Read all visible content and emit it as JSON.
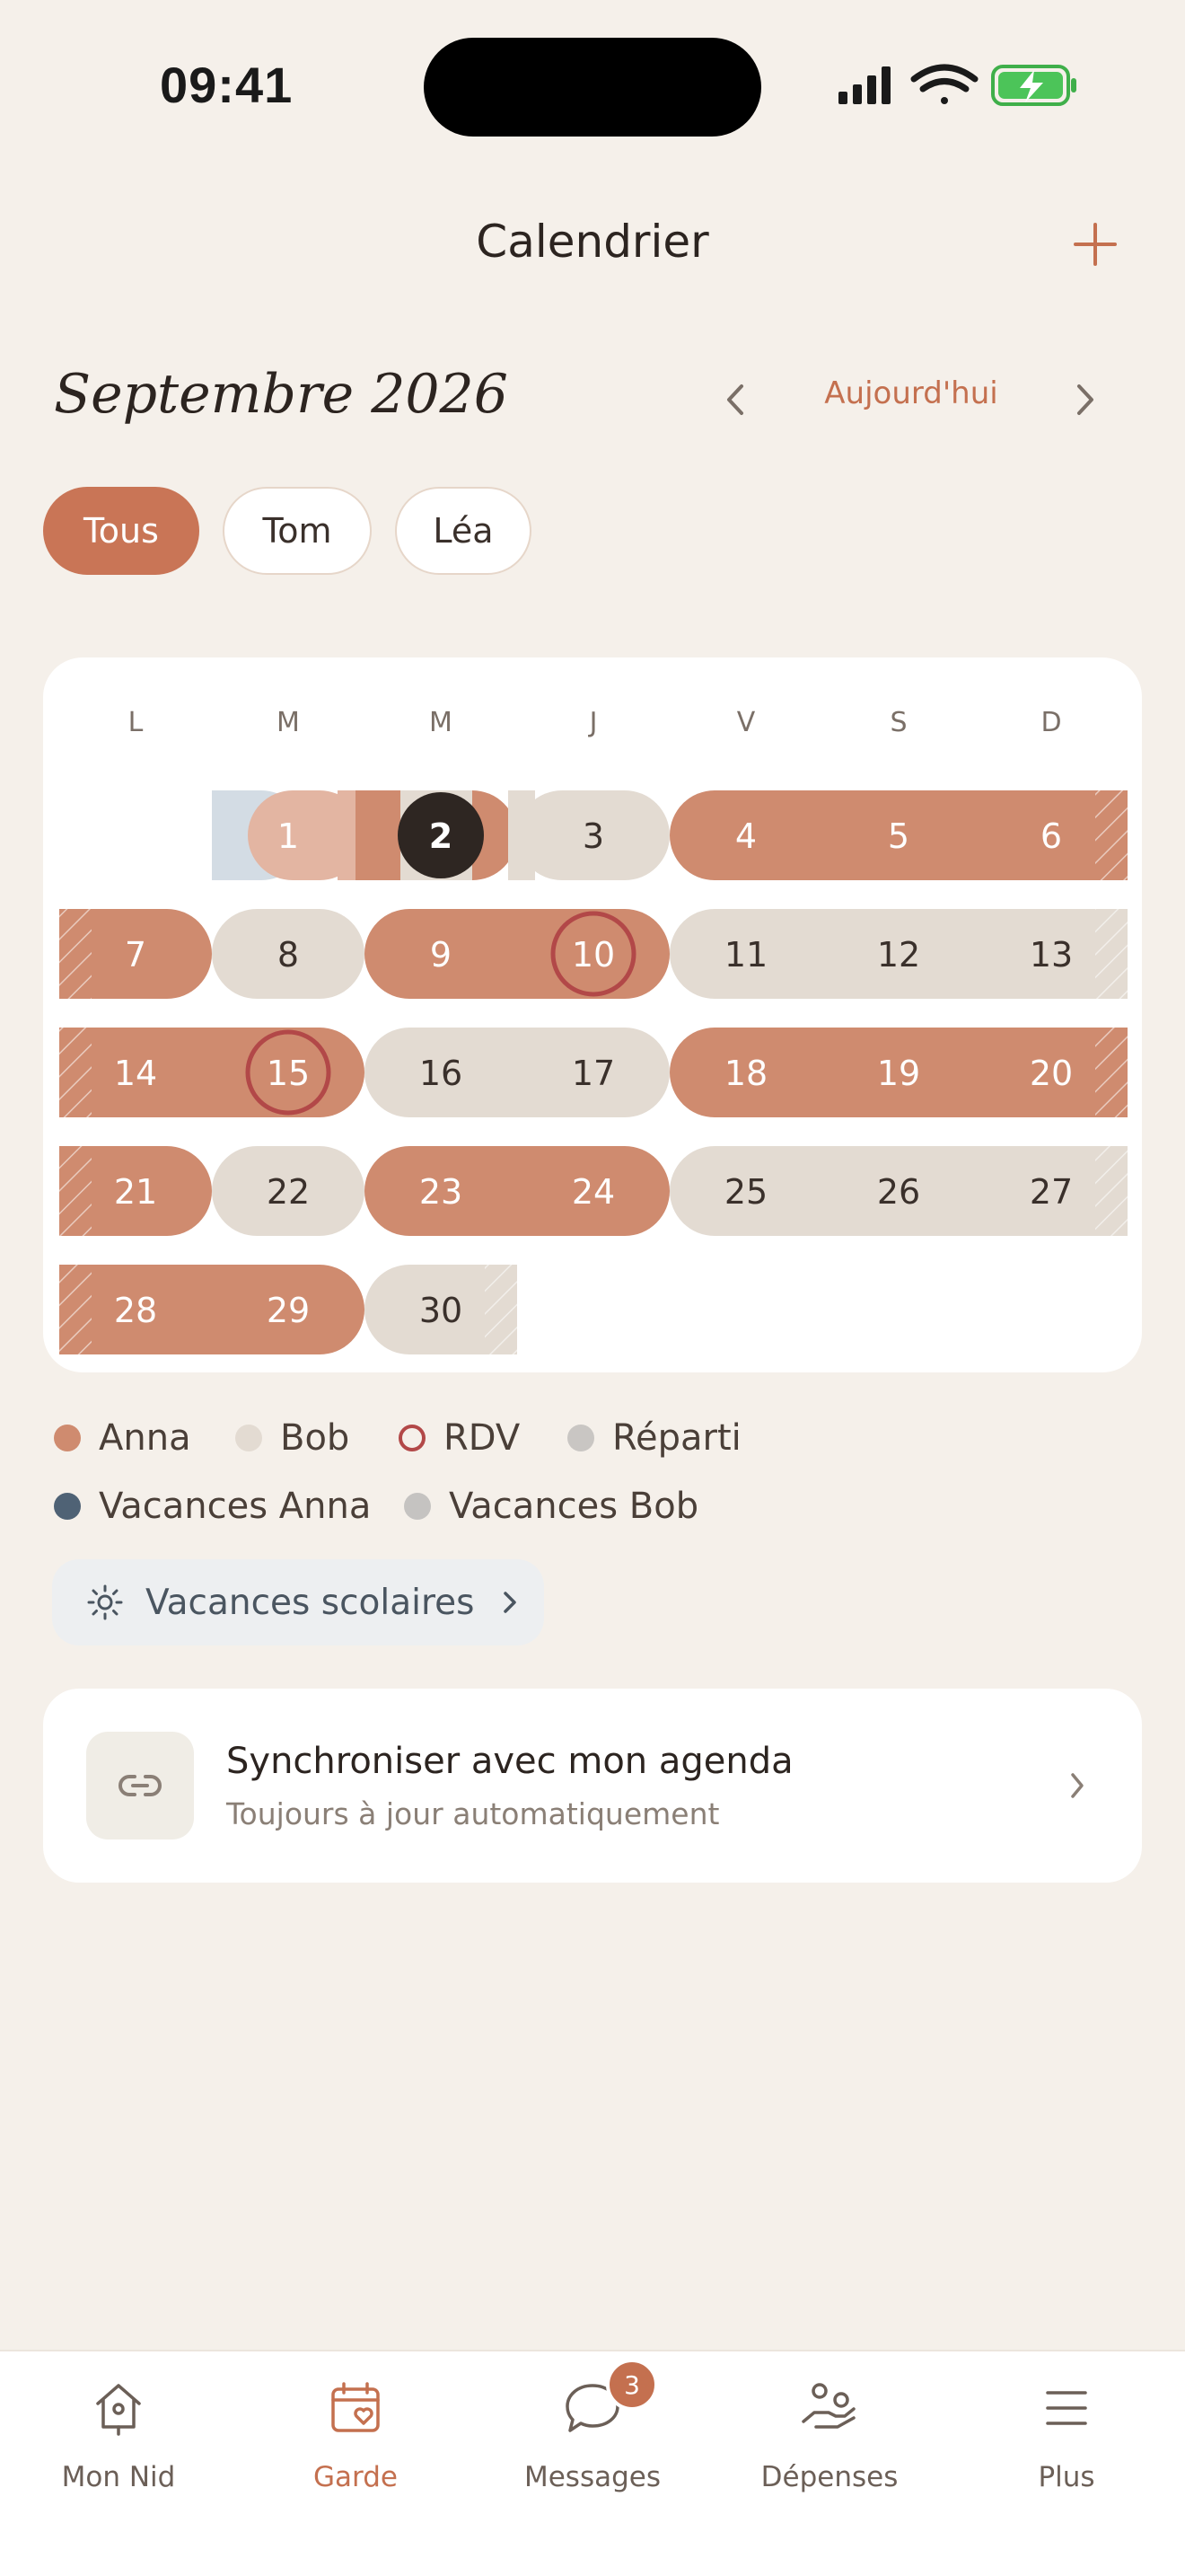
{
  "status_bar": {
    "time": "09:41"
  },
  "header": {
    "title": "Calendrier",
    "add_icon": "plus-icon"
  },
  "month": {
    "title": "Septembre 2026",
    "today_label": "Aujourd'hui"
  },
  "filters": [
    {
      "label": "Tous",
      "active": true
    },
    {
      "label": "Tom",
      "active": false
    },
    {
      "label": "Léa",
      "active": false
    }
  ],
  "calendar": {
    "weekdays": [
      "L",
      "M",
      "M",
      "J",
      "V",
      "S",
      "D"
    ],
    "today": 2,
    "appointments": [
      10,
      15
    ],
    "weeks": [
      [
        null,
        1,
        2,
        3,
        4,
        5,
        6
      ],
      [
        7,
        8,
        9,
        10,
        11,
        12,
        13
      ],
      [
        14,
        15,
        16,
        17,
        18,
        19,
        20
      ],
      [
        21,
        22,
        23,
        24,
        25,
        26,
        27
      ],
      [
        28,
        29,
        30,
        null,
        null,
        null,
        null
      ]
    ],
    "custody": {
      "1": "vacances-anna",
      "2": "anna",
      "3": "bob",
      "4": "anna",
      "5": "anna",
      "6": "anna",
      "7": "anna",
      "8": "bob",
      "9": "anna",
      "10": "anna",
      "11": "bob",
      "12": "bob",
      "13": "bob",
      "14": "anna",
      "15": "anna",
      "16": "bob",
      "17": "bob",
      "18": "anna",
      "19": "anna",
      "20": "anna",
      "21": "anna",
      "22": "bob",
      "23": "anna",
      "24": "anna",
      "25": "bob",
      "26": "bob",
      "27": "bob",
      "28": "anna",
      "29": "anna",
      "30": "bob"
    }
  },
  "legend": [
    {
      "label": "Anna",
      "color": "#CF8B6F",
      "style": "fill"
    },
    {
      "label": "Bob",
      "color": "#E3DBD2",
      "style": "fill"
    },
    {
      "label": "RDV",
      "color": "#B24848",
      "style": "ring"
    },
    {
      "label": "Réparti",
      "color": "#C9C6C3",
      "style": "fill"
    },
    {
      "label": "Vacances Anna",
      "color": "#4F6275",
      "style": "fill"
    },
    {
      "label": "Vacances Bob",
      "color": "#C5C3C1",
      "style": "fill"
    }
  ],
  "school_holidays": {
    "label": "Vacances scolaires",
    "icon": "sun-icon"
  },
  "sync": {
    "title": "Synchroniser avec mon agenda",
    "subtitle": "Toujours à jour automatiquement",
    "icon": "link-icon"
  },
  "tabs": [
    {
      "label": "Mon Nid",
      "icon": "birdhouse-icon",
      "active": false
    },
    {
      "label": "Garde",
      "icon": "calendar-heart-icon",
      "active": true
    },
    {
      "label": "Messages",
      "icon": "chat-bubble-icon",
      "active": false,
      "badge": "3"
    },
    {
      "label": "Dépenses",
      "icon": "hand-coins-icon",
      "active": false
    },
    {
      "label": "Plus",
      "icon": "menu-icon",
      "active": false
    }
  ],
  "colors": {
    "accent": "#C4704F",
    "anna": "#CF8B6F",
    "bob": "#E3DBD2",
    "vacances_anna_light": "#D3DCE4",
    "rdv": "#B24848",
    "background": "#F5F0EA"
  }
}
